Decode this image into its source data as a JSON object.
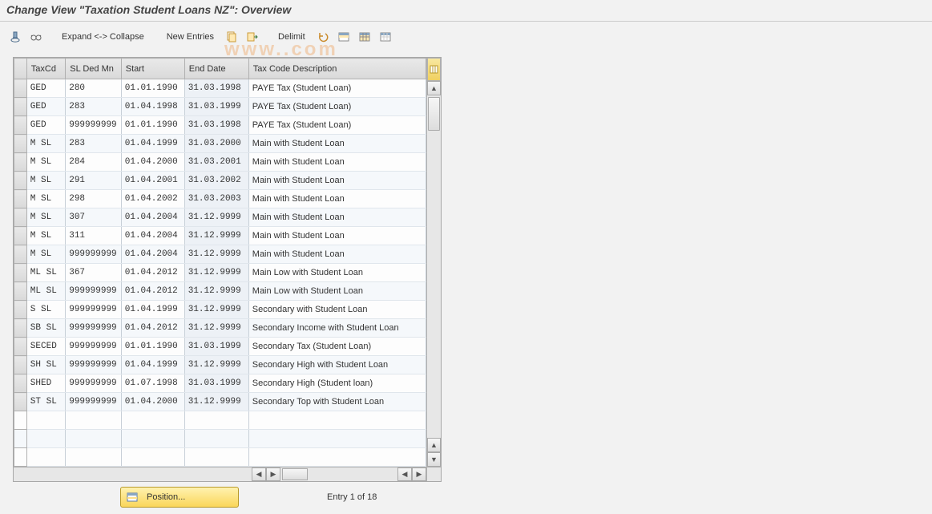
{
  "title": "Change View \"Taxation Student Loans NZ\": Overview",
  "watermark": {
    "left": "www.",
    "mid_pale": "",
    "right": ".com"
  },
  "toolbar": {
    "expand_collapse": "Expand <-> Collapse",
    "new_entries": "New Entries",
    "delimit": "Delimit"
  },
  "columns": {
    "taxcd": "TaxCd",
    "sldedmn": "SL Ded Mn",
    "start": "Start",
    "enddate": "End Date",
    "desc": "Tax Code Description"
  },
  "rows": [
    {
      "taxcd": "GED",
      "sl": "280",
      "start": "01.01.1990",
      "end": "31.03.1998",
      "desc": "PAYE Tax (Student Loan)"
    },
    {
      "taxcd": "GED",
      "sl": "283",
      "start": "01.04.1998",
      "end": "31.03.1999",
      "desc": "PAYE Tax (Student Loan)"
    },
    {
      "taxcd": "GED",
      "sl": "999999999",
      "start": "01.01.1990",
      "end": "31.03.1998",
      "desc": "PAYE Tax (Student Loan)"
    },
    {
      "taxcd": "M SL",
      "sl": "283",
      "start": "01.04.1999",
      "end": "31.03.2000",
      "desc": "Main with Student Loan"
    },
    {
      "taxcd": "M SL",
      "sl": "284",
      "start": "01.04.2000",
      "end": "31.03.2001",
      "desc": "Main with Student Loan"
    },
    {
      "taxcd": "M SL",
      "sl": "291",
      "start": "01.04.2001",
      "end": "31.03.2002",
      "desc": "Main with Student Loan"
    },
    {
      "taxcd": "M SL",
      "sl": "298",
      "start": "01.04.2002",
      "end": "31.03.2003",
      "desc": "Main with Student Loan"
    },
    {
      "taxcd": "M SL",
      "sl": "307",
      "start": "01.04.2004",
      "end": "31.12.9999",
      "desc": "Main with Student Loan"
    },
    {
      "taxcd": "M SL",
      "sl": "311",
      "start": "01.04.2004",
      "end": "31.12.9999",
      "desc": "Main with Student Loan"
    },
    {
      "taxcd": "M SL",
      "sl": "999999999",
      "start": "01.04.2004",
      "end": "31.12.9999",
      "desc": "Main with Student Loan"
    },
    {
      "taxcd": "ML SL",
      "sl": "367",
      "start": "01.04.2012",
      "end": "31.12.9999",
      "desc": "Main Low with Student Loan"
    },
    {
      "taxcd": "ML SL",
      "sl": "999999999",
      "start": "01.04.2012",
      "end": "31.12.9999",
      "desc": "Main Low with Student Loan"
    },
    {
      "taxcd": "S SL",
      "sl": "999999999",
      "start": "01.04.1999",
      "end": "31.12.9999",
      "desc": "Secondary with Student Loan"
    },
    {
      "taxcd": "SB SL",
      "sl": "999999999",
      "start": "01.04.2012",
      "end": "31.12.9999",
      "desc": "Secondary Income with Student Loan"
    },
    {
      "taxcd": "SECED",
      "sl": "999999999",
      "start": "01.01.1990",
      "end": "31.03.1999",
      "desc": "Secondary Tax (Student Loan)"
    },
    {
      "taxcd": "SH SL",
      "sl": "999999999",
      "start": "01.04.1999",
      "end": "31.12.9999",
      "desc": "Secondary High with Student Loan"
    },
    {
      "taxcd": "SHED",
      "sl": "999999999",
      "start": "01.07.1998",
      "end": "31.03.1999",
      "desc": "Secondary High (Student loan)"
    },
    {
      "taxcd": "ST SL",
      "sl": "999999999",
      "start": "01.04.2000",
      "end": "31.12.9999",
      "desc": "Secondary Top with Student Loan"
    }
  ],
  "emptyRows": 3,
  "footer": {
    "position_label": "Position...",
    "entry_text": "Entry 1 of 18"
  }
}
